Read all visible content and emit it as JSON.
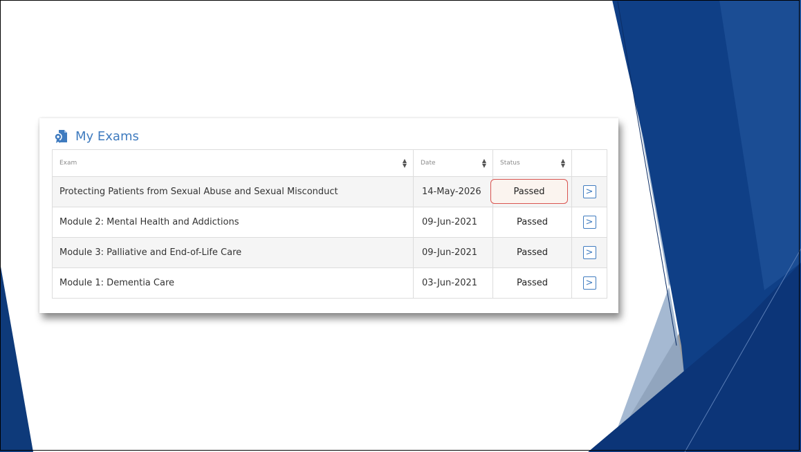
{
  "exams_panel": {
    "title": "My Exams",
    "columns": {
      "exam": "Exam",
      "date": "Date",
      "status": "Status"
    },
    "rows": [
      {
        "exam": "Protecting Patients from Sexual Abuse and Sexual Misconduct",
        "date": "14-May-2026",
        "status": "Passed"
      },
      {
        "exam": "Module 2: Mental Health and Addictions",
        "date": "09-Jun-2021",
        "status": "Passed"
      },
      {
        "exam": "Module 3: Palliative and End-of-Life Care",
        "date": "09-Jun-2021",
        "status": "Passed"
      },
      {
        "exam": "Module 1: Dementia Care",
        "date": "03-Jun-2021",
        "status": "Passed"
      }
    ],
    "highlighted_row": 0,
    "action_icon": "chevron-right-icon"
  },
  "colors": {
    "accent": "#3f7bbf",
    "highlight_border": "#d9534f",
    "deco_dark_blue": "#0e3a7a",
    "deco_grey": "#9a9a9a"
  }
}
